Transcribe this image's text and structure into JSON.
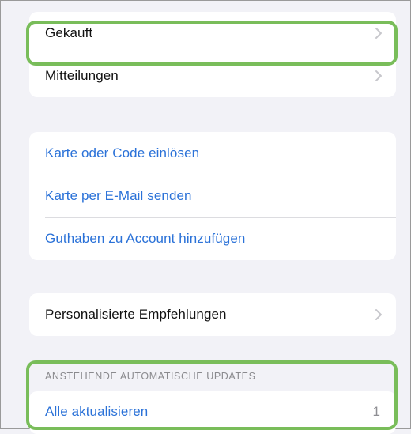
{
  "group1": {
    "purchased_label": "Gekauft",
    "notifications_label": "Mitteilungen"
  },
  "group2": {
    "redeem_label": "Karte oder Code einlösen",
    "send_card_label": "Karte per E-Mail senden",
    "add_funds_label": "Guthaben zu Account hinzufügen"
  },
  "group3": {
    "personalized_label": "Personalisierte Empfehlungen"
  },
  "updates_section": {
    "header": "ANSTEHENDE AUTOMATISCHE UPDATES",
    "update_all_label": "Alle aktualisieren",
    "count": "1"
  },
  "colors": {
    "link": "#2b72d8",
    "highlight": "#79bd5a",
    "background": "#f2f2f7"
  },
  "icons": {
    "row_disclosure": "chevron-right-icon"
  }
}
